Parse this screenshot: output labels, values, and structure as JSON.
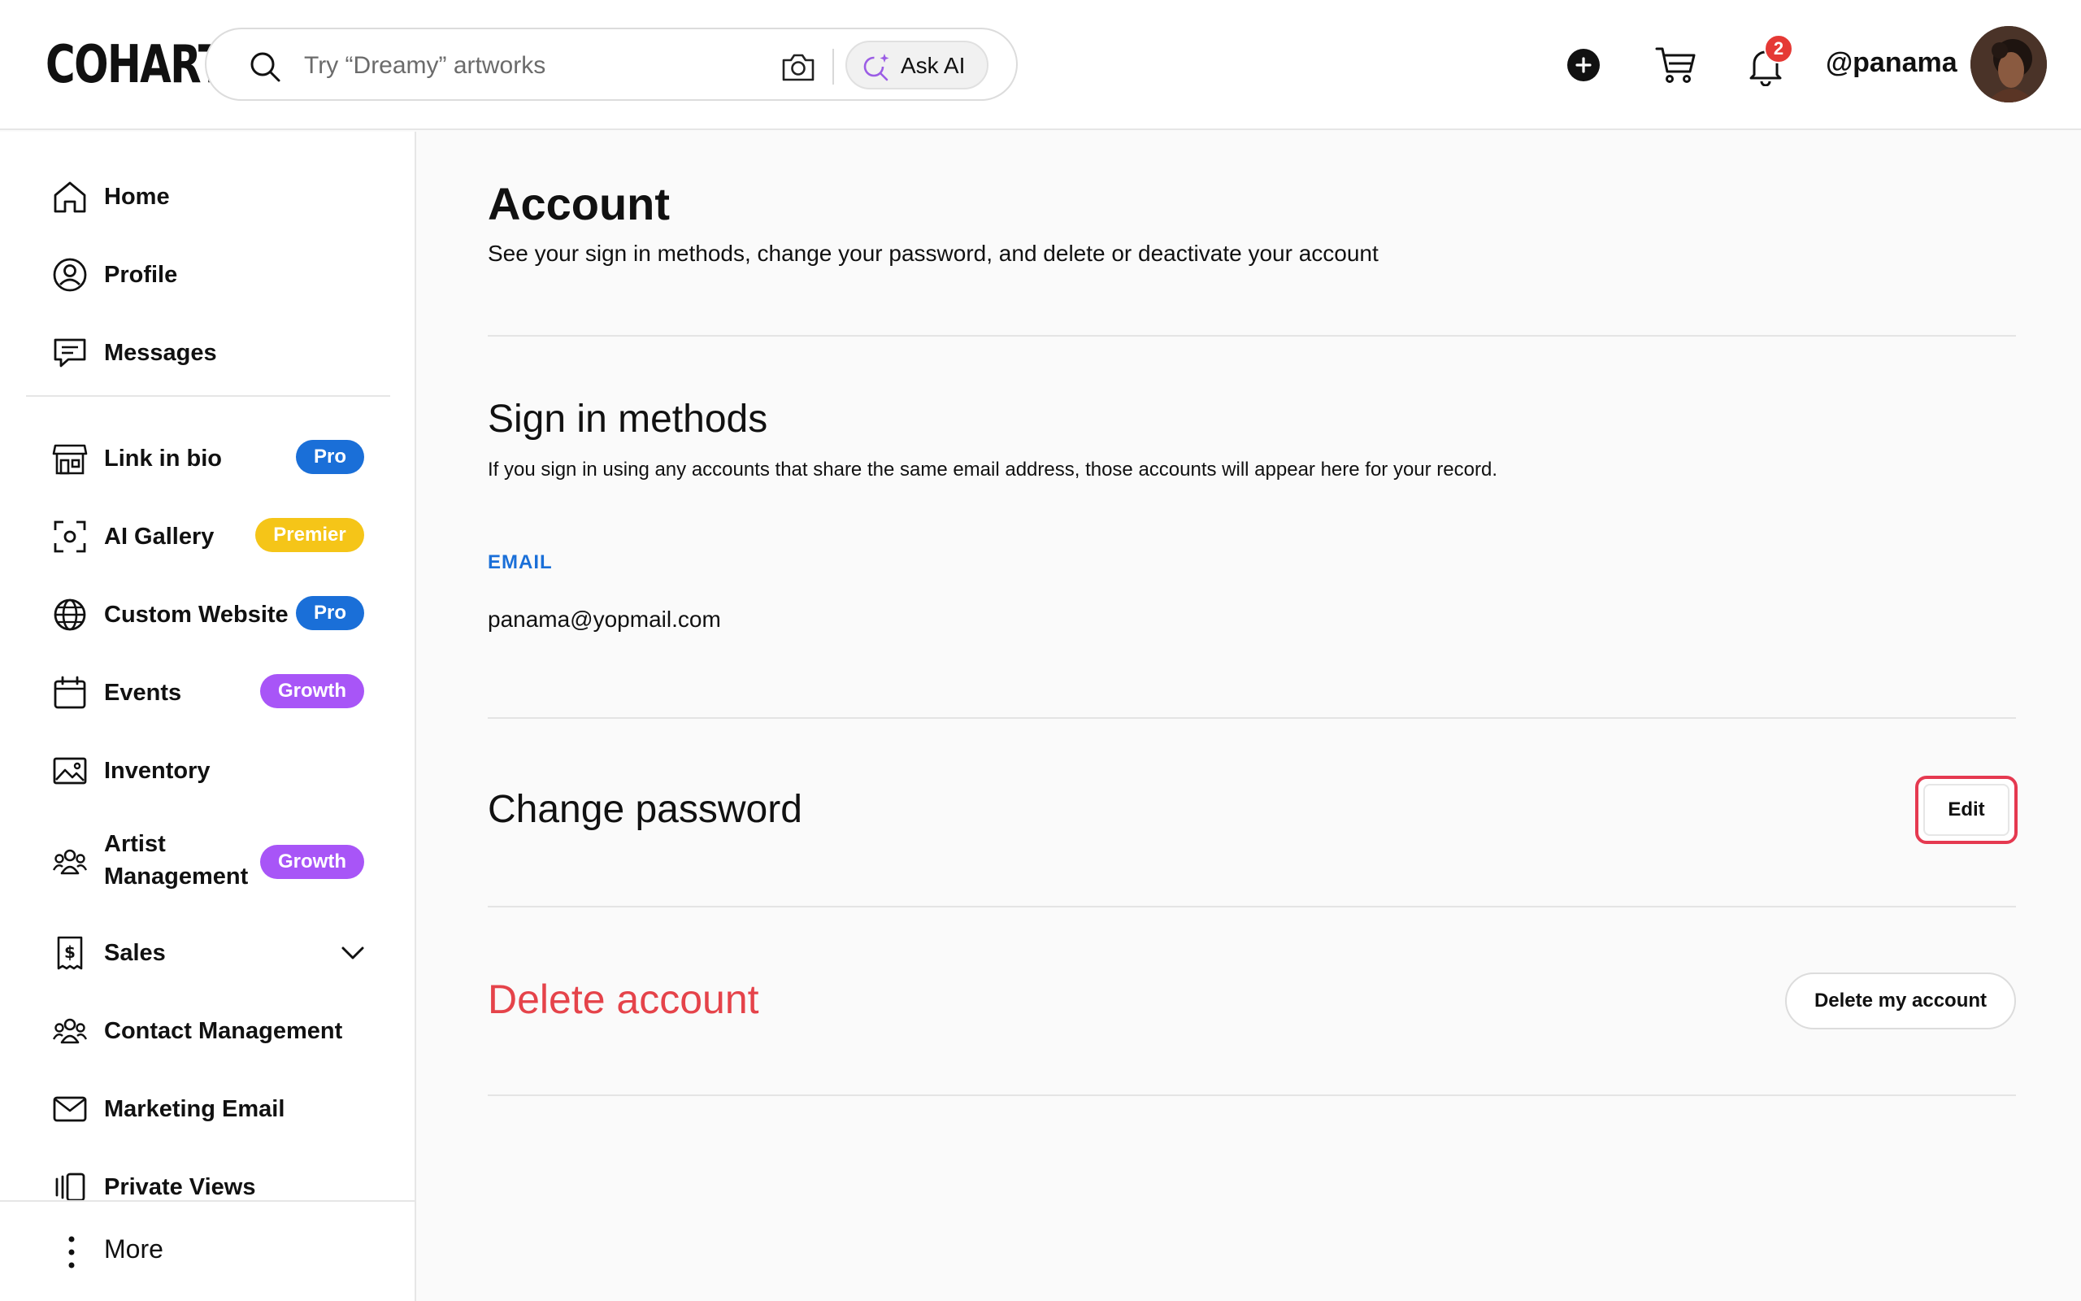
{
  "header": {
    "logo": "COHART",
    "search_placeholder": "Try “Dreamy” artworks",
    "ask_ai_label": "Ask AI",
    "notification_count": "2",
    "username": "@panama"
  },
  "sidebar": {
    "primary": [
      {
        "label": "Home",
        "icon": "home-icon"
      },
      {
        "label": "Profile",
        "icon": "profile-icon"
      },
      {
        "label": "Messages",
        "icon": "messages-icon"
      }
    ],
    "secondary": [
      {
        "label": "Link in bio",
        "icon": "storefront-icon",
        "badge": "Pro",
        "badge_color": "#1a6fd8"
      },
      {
        "label": "AI Gallery",
        "icon": "scan-icon",
        "badge": "Premier",
        "badge_color": "#f5c518"
      },
      {
        "label": "Custom Website",
        "icon": "globe-icon",
        "badge": "Pro",
        "badge_color": "#1a6fd8"
      },
      {
        "label": "Events",
        "icon": "calendar-icon",
        "badge": "Growth",
        "badge_color": "#a855f7"
      },
      {
        "label": "Inventory",
        "icon": "image-icon"
      },
      {
        "label": "Artist Management",
        "icon": "group-icon",
        "badge": "Growth",
        "badge_color": "#a855f7"
      },
      {
        "label": "Sales",
        "icon": "dollar-receipt-icon",
        "expandable": true
      },
      {
        "label": "Contact Management",
        "icon": "contacts-icon"
      },
      {
        "label": "Marketing Email",
        "icon": "mail-icon"
      },
      {
        "label": "Private Views",
        "icon": "views-icon"
      }
    ],
    "more_label": "More"
  },
  "main": {
    "title": "Account",
    "subtitle": "See your sign in methods, change your password, and delete or deactivate your account",
    "sign_in": {
      "title": "Sign in methods",
      "description": "If you sign in using any accounts that share the same email address, those accounts will appear here for your record.",
      "email_label": "EMAIL",
      "email_value": "panama@yopmail.com"
    },
    "change_password": {
      "title": "Change password",
      "edit_label": "Edit"
    },
    "delete_account": {
      "title": "Delete account",
      "button_label": "Delete my account"
    }
  },
  "colors": {
    "accent_blue": "#1a6fd8",
    "danger_red": "#e5434a",
    "premier_yellow": "#f5c518",
    "growth_purple": "#a855f7"
  }
}
